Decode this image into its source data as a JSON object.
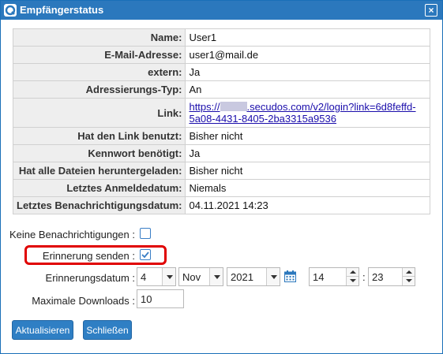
{
  "dialog": {
    "title": "Empfängerstatus",
    "close_glyph": "×",
    "accent_color": "#2b78bd"
  },
  "info": {
    "rows": [
      {
        "label": "Name:",
        "value": "User1"
      },
      {
        "label": "E-Mail-Adresse:",
        "value": "user1@mail.de"
      },
      {
        "label": "extern:",
        "value": "Ja"
      },
      {
        "label": "Adressierungs-Typ:",
        "value": "An"
      },
      {
        "label": "Link:",
        "link_prefix": "https://",
        "link_rest": ".secudos.com/v2/login?link=6d8feffd-5a08-4431-8405-2ba3315a9536"
      },
      {
        "label": "Hat den Link benutzt:",
        "value": "Bisher nicht"
      },
      {
        "label": "Kennwort benötigt:",
        "value": "Ja"
      },
      {
        "label": "Hat alle Dateien heruntergeladen:",
        "value": "Bisher nicht"
      },
      {
        "label": "Letztes Anmeldedatum:",
        "value": "Niemals"
      },
      {
        "label": "Letztes Benachrichtigungsdatum:",
        "value": "04.11.2021 14:23"
      }
    ]
  },
  "form": {
    "no_notifications_label": "Keine Benachrichtigungen :",
    "no_notifications_checked": false,
    "reminder_label": "Erinnerung senden :",
    "reminder_checked": true,
    "reminder_date_label": "Erinnerungsdatum :",
    "day": "4",
    "month": "Nov",
    "year": "2021",
    "hour": "14",
    "time_separator": ":",
    "minute": "23",
    "max_downloads_label": "Maximale Downloads :",
    "max_downloads": "10"
  },
  "buttons": {
    "update": "Aktualisieren",
    "close": "Schließen"
  },
  "icons": {
    "title_icon": "app-logo-icon",
    "calendar_icon": "calendar-icon",
    "checkbox_check": "checkmark-icon"
  }
}
